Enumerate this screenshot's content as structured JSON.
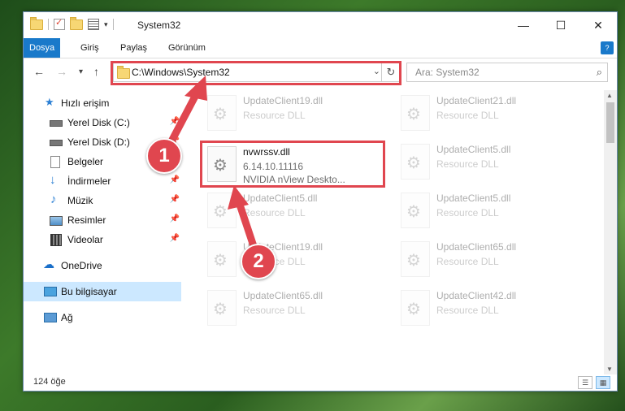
{
  "window": {
    "title": "System32",
    "controls": {
      "minimize": "—",
      "maximize": "☐",
      "close": "✕"
    }
  },
  "ribbon": {
    "tabs": [
      "Dosya",
      "Giriş",
      "Paylaş",
      "Görünüm"
    ]
  },
  "navigation": {
    "address": "C:\\Windows\\System32",
    "search_placeholder": "Ara: System32"
  },
  "sidebar": {
    "items": [
      {
        "label": "Hızlı erişim",
        "icon": "star-icon"
      },
      {
        "label": "Yerel Disk (C:)",
        "icon": "drive-icon",
        "pinned": true
      },
      {
        "label": "Yerel Disk (D:)",
        "icon": "drive-icon",
        "pinned": true
      },
      {
        "label": "Belgeler",
        "icon": "documents-icon",
        "pinned": true
      },
      {
        "label": "İndirmeler",
        "icon": "download-icon",
        "pinned": true
      },
      {
        "label": "Müzik",
        "icon": "music-icon",
        "pinned": true
      },
      {
        "label": "Resimler",
        "icon": "pictures-icon",
        "pinned": true
      },
      {
        "label": "Videolar",
        "icon": "video-icon",
        "pinned": true
      },
      {
        "label": "OneDrive",
        "icon": "cloud-icon"
      },
      {
        "label": "Bu bilgisayar",
        "icon": "computer-icon",
        "selected": true
      },
      {
        "label": "Ağ",
        "icon": "network-icon"
      }
    ]
  },
  "files": {
    "highlighted": {
      "name": "nvwrssv.dll",
      "version": "6.14.10.11116",
      "description": "NVIDIA nView Deskto..."
    },
    "background": [
      {
        "name": "UpdateClient19.dll",
        "type": "Resource DLL"
      },
      {
        "name": "UpdateClient21.dll",
        "type": "Resource DLL"
      },
      {
        "name": "UpdateClient5.dll",
        "type": "Resource DLL"
      },
      {
        "name": "UpdateClient5.dll",
        "type": "Resource DLL"
      },
      {
        "name": "UpdateClient5.dll",
        "type": "Resource DLL"
      },
      {
        "name": "UpdateClient19.dll",
        "type": "Resource DLL"
      },
      {
        "name": "UpdateClient65.dll",
        "type": "Resource DLL"
      },
      {
        "name": "UpdateClient65.dll",
        "type": "Resource DLL"
      },
      {
        "name": "UpdateClient42.dll",
        "type": "Resource DLL"
      }
    ]
  },
  "status": {
    "item_count": "124 öğe"
  },
  "callouts": {
    "one": "1",
    "two": "2"
  },
  "colors": {
    "accent": "#1979ca",
    "highlight": "#e0464f",
    "selected": "#cce8ff"
  }
}
